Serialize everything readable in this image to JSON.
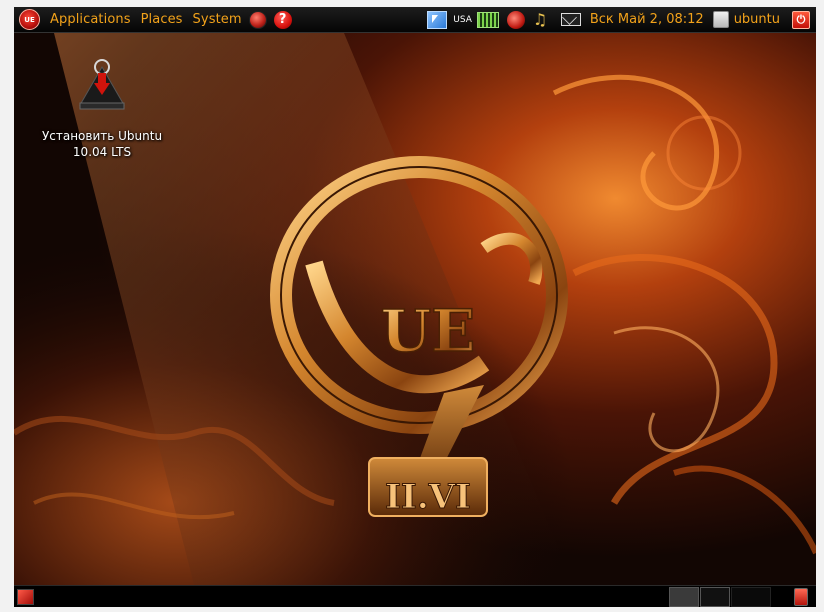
{
  "top_panel": {
    "logo_text": "UE",
    "menus": [
      "Applications",
      "Places",
      "System"
    ],
    "help_glyph": "?",
    "keyboard_layout": "USA",
    "clock": "Вск Май  2, 08:12",
    "user": "ubuntu",
    "power_glyph": "⏻",
    "icons": [
      "ue-logo-icon",
      "globe-icon",
      "help-icon",
      "cursor-icon",
      "keyboard-icon",
      "network-icon",
      "music-icon",
      "mail-icon",
      "user-icon",
      "power-icon"
    ]
  },
  "desktop": {
    "icon_label_line1": "Установить Ubuntu",
    "icon_label_line2": "10.04 LTS",
    "icon_name": "install-ubuntu-icon"
  },
  "wallpaper": {
    "emblem_text": "UE",
    "version_text": "II.VI",
    "colors": {
      "fire": "#e0601a",
      "gold": "#c07a2a",
      "dark": "#140803"
    }
  },
  "bottom_panel": {
    "icons": [
      "show-desktop-icon",
      "workspace-switcher",
      "trash-icon"
    ]
  }
}
